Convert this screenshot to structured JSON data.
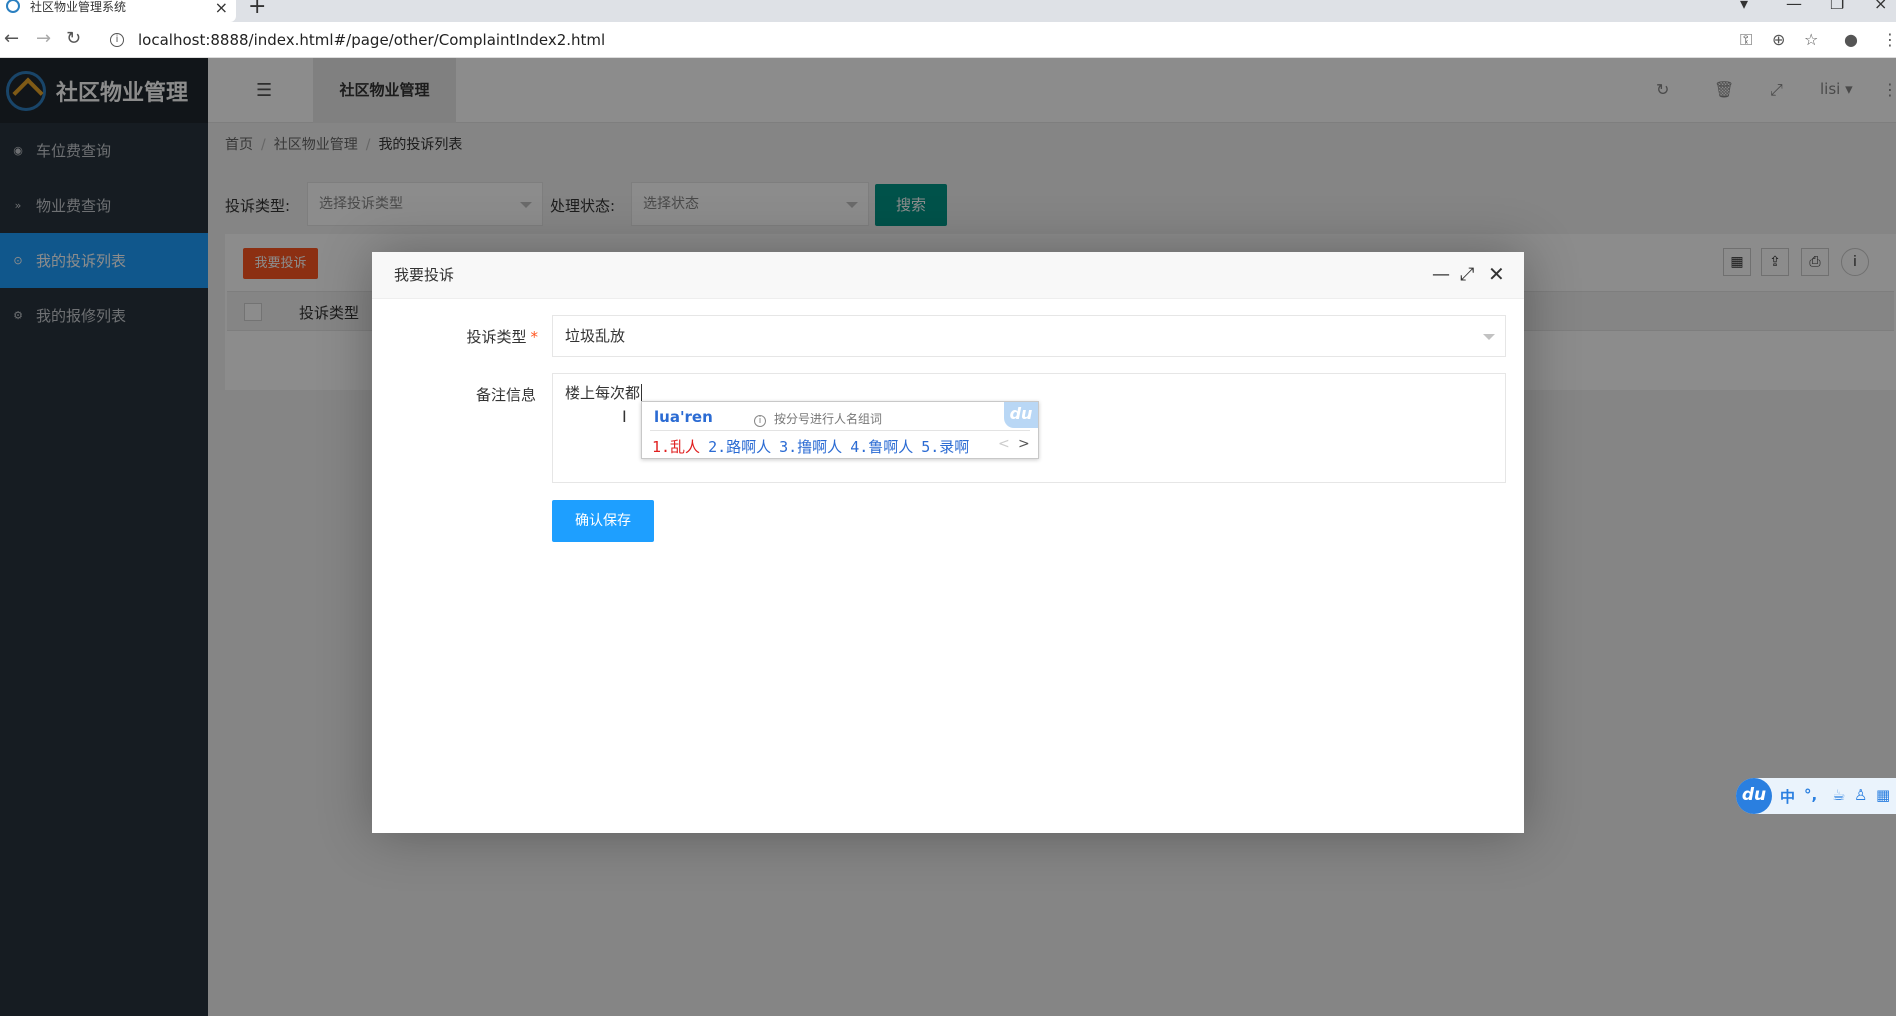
{
  "browser": {
    "tab_title": "社区物业管理系统",
    "url": "localhost:8888/index.html#/page/other/ComplaintIndex2.html"
  },
  "sidebar": {
    "logo_text": "社区物业管理",
    "items": [
      {
        "label": "车位费查询",
        "icon": "dashboard-icon"
      },
      {
        "label": "物业费查询",
        "icon": "double-chevron-down-icon"
      },
      {
        "label": "我的投诉列表",
        "icon": "target-icon"
      },
      {
        "label": "我的报修列表",
        "icon": "gear-icon"
      }
    ],
    "active_index": 2
  },
  "header": {
    "tab_label": "社区物业管理",
    "user": "lisi"
  },
  "breadcrumb": {
    "home": "首页",
    "section": "社区物业管理",
    "current": "我的投诉列表",
    "sep": "/"
  },
  "search": {
    "type_label": "投诉类型:",
    "type_placeholder": "选择投诉类型",
    "status_label": "处理状态:",
    "status_placeholder": "选择状态",
    "button": "搜索"
  },
  "table": {
    "add_button": "我要投诉",
    "columns": [
      "投诉类型"
    ]
  },
  "modal": {
    "title": "我要投诉",
    "type_label": "投诉类型",
    "required_mark": "*",
    "type_value": "垃圾乱放",
    "remark_label": "备注信息",
    "remark_value": "楼上每次都",
    "save_button": "确认保存"
  },
  "ime": {
    "composition": "lua'ren",
    "hint": "按分号进行人名组词",
    "logo": "du",
    "candidates": [
      "1.乱人",
      "2.路啊人",
      "3.撸啊人",
      "4.鲁啊人",
      "5.录啊"
    ],
    "status_items": [
      "中",
      "°,"
    ]
  }
}
